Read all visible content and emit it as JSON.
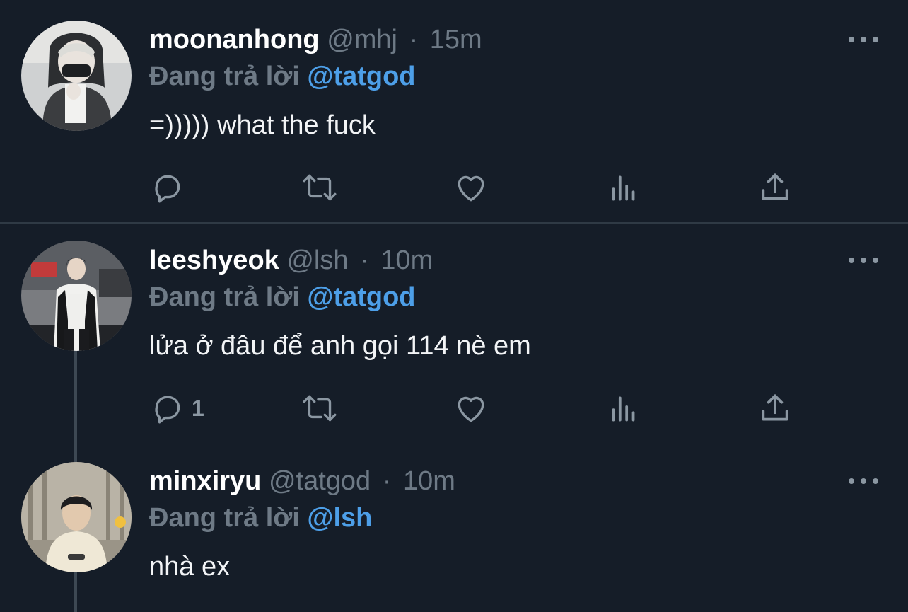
{
  "tweets": [
    {
      "display_name": "moonanhong",
      "handle": "@mhj",
      "separator": "·",
      "time": "15m",
      "reply_prefix": "Đang trả lời",
      "reply_to": "@tatgod",
      "text": "=))))) what the fuck",
      "reply_count": ""
    },
    {
      "display_name": "leeshyeok",
      "handle": "@lsh",
      "separator": "·",
      "time": "10m",
      "reply_prefix": "Đang trả lời",
      "reply_to": "@tatgod",
      "text": "lửa ở đâu để anh gọi 114 nè em",
      "reply_count": "1"
    },
    {
      "display_name": "minxiryu",
      "handle": "@tatgod",
      "separator": "·",
      "time": "10m",
      "reply_prefix": "Đang trả lời",
      "reply_to": "@lsh",
      "text": "nhà ex"
    }
  ],
  "colors": {
    "background": "#151d28",
    "mention": "#4d9fe8",
    "muted": "#6e7a86",
    "text": "#f2f4f6"
  },
  "icons": [
    "more-icon",
    "reply-icon",
    "retweet-icon",
    "like-icon",
    "views-icon",
    "share-icon"
  ]
}
